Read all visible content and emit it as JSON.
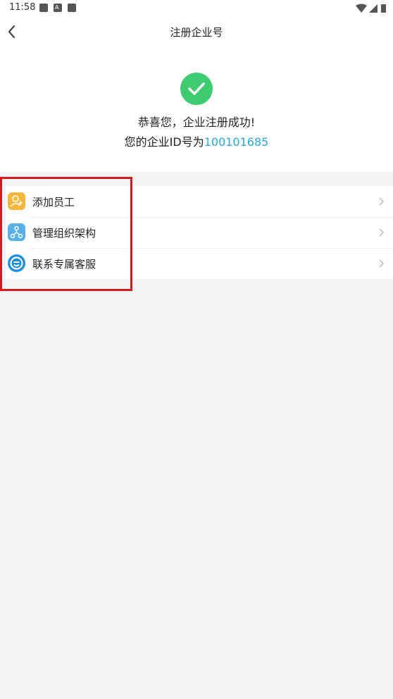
{
  "status_bar": {
    "time": "11:58"
  },
  "header": {
    "title": "注册企业号"
  },
  "success": {
    "message": "恭喜您，企业注册成功!",
    "id_prefix": "您的企业ID号为",
    "id_value": "100101685"
  },
  "menu": {
    "items": [
      {
        "label": "添加员工",
        "icon": "add-user-icon"
      },
      {
        "label": "管理组织架构",
        "icon": "org-structure-icon"
      },
      {
        "label": "联系专属客服",
        "icon": "customer-service-icon"
      }
    ]
  },
  "colors": {
    "success_green": "#3fcb6f",
    "id_blue": "#2aa8d8",
    "highlight_red": "#d6181f"
  }
}
